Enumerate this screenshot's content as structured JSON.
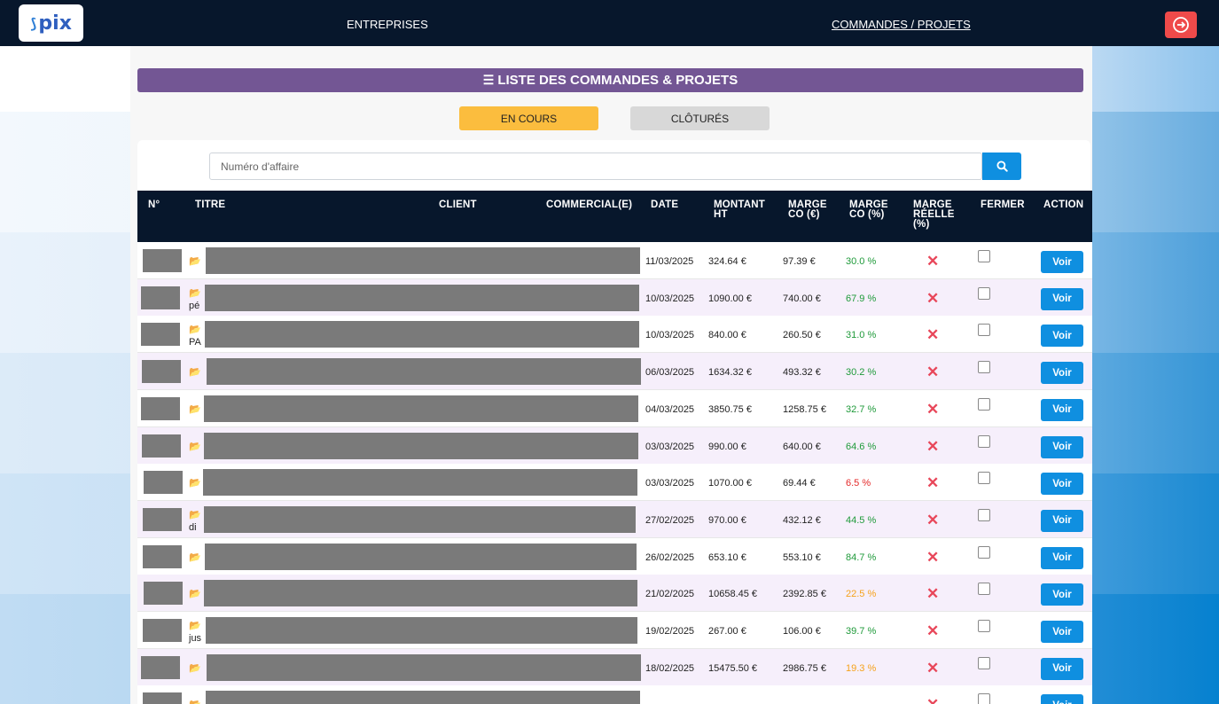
{
  "nav": {
    "logo_text": "pix",
    "entreprises": "ENTREPRISES",
    "commandes": "COMMANDES / PROJETS"
  },
  "page": {
    "title": "LISTE DES COMMANDES & PROJETS",
    "tab_active": "EN COURS",
    "tab_closed": "CLÔTURÉS",
    "search_placeholder": "Numéro d'affaire"
  },
  "table": {
    "headers": {
      "num": "N°",
      "titre": "TITRE",
      "client": "CLIENT",
      "commercial": "COMMERCIAL(E)",
      "date": "DATE",
      "montant_1": "MONTANT",
      "montant_2": "HT",
      "marge_co_eur_1": "MARGE",
      "marge_co_eur_2": "CO (€)",
      "marge_co_pct_1": "MARGE",
      "marge_co_pct_2": "CO (%)",
      "marge_reelle_1": "MARGE",
      "marge_reelle_2": "RÉELLE",
      "marge_reelle_3": "(%)",
      "fermer": "FERMER",
      "action": "ACTION"
    },
    "voir_label": "Voir",
    "rows": [
      {
        "date": "11/03/2025",
        "montant": "324.64 €",
        "marge_eur": "97.39 €",
        "marge_pct": "30.0 %",
        "pct_color": "green",
        "subtext": ""
      },
      {
        "date": "10/03/2025",
        "montant": "1090.00 €",
        "marge_eur": "740.00 €",
        "marge_pct": "67.9 %",
        "pct_color": "green",
        "subtext": "pé"
      },
      {
        "date": "10/03/2025",
        "montant": "840.00 €",
        "marge_eur": "260.50 €",
        "marge_pct": "31.0 %",
        "pct_color": "green",
        "subtext": "PA"
      },
      {
        "date": "06/03/2025",
        "montant": "1634.32 €",
        "marge_eur": "493.32 €",
        "marge_pct": "30.2 %",
        "pct_color": "green",
        "subtext": ""
      },
      {
        "date": "04/03/2025",
        "montant": "3850.75 €",
        "marge_eur": "1258.75 €",
        "marge_pct": "32.7 %",
        "pct_color": "green",
        "subtext": ""
      },
      {
        "date": "03/03/2025",
        "montant": "990.00 €",
        "marge_eur": "640.00 €",
        "marge_pct": "64.6 %",
        "pct_color": "green",
        "subtext": ""
      },
      {
        "date": "03/03/2025",
        "montant": "1070.00 €",
        "marge_eur": "69.44 €",
        "marge_pct": "6.5 %",
        "pct_color": "red",
        "subtext": ""
      },
      {
        "date": "27/02/2025",
        "montant": "970.00 €",
        "marge_eur": "432.12 €",
        "marge_pct": "44.5 %",
        "pct_color": "green",
        "subtext": "di"
      },
      {
        "date": "26/02/2025",
        "montant": "653.10 €",
        "marge_eur": "553.10 €",
        "marge_pct": "84.7 %",
        "pct_color": "green",
        "subtext": ""
      },
      {
        "date": "21/02/2025",
        "montant": "10658.45 €",
        "marge_eur": "2392.85 €",
        "marge_pct": "22.5 %",
        "pct_color": "orange",
        "subtext": ""
      },
      {
        "date": "19/02/2025",
        "montant": "267.00 €",
        "marge_eur": "106.00 €",
        "marge_pct": "39.7 %",
        "pct_color": "green",
        "subtext": "jus"
      },
      {
        "date": "18/02/2025",
        "montant": "15475.50 €",
        "marge_eur": "2986.75 €",
        "marge_pct": "19.3 %",
        "pct_color": "orange",
        "subtext": ""
      },
      {
        "date": "",
        "montant": "",
        "marge_eur": "",
        "marge_pct": "",
        "pct_color": "green",
        "subtext": ""
      }
    ]
  },
  "colors": {
    "navbar": "#07172c",
    "title_bar": "#735694",
    "tab_active": "#fbbd3e",
    "primary_button": "#0f8fe0",
    "logout": "#ef4a4a",
    "row_alt": "#f6effb"
  },
  "icons": {
    "logo": "pix-logo",
    "logout": "logout-icon",
    "title": "list-icon",
    "search": "search-icon",
    "folder": "folder-open-icon",
    "close_status": "x-mark-icon"
  }
}
